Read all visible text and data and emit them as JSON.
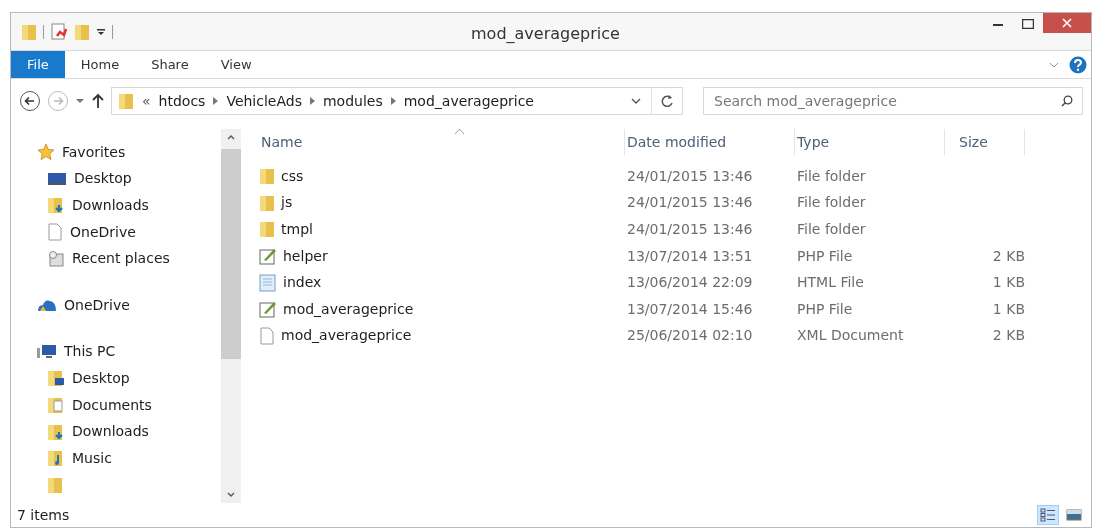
{
  "window": {
    "title": "mod_averageprice"
  },
  "ribbon_tabs": [
    {
      "label": "File",
      "selected": true
    },
    {
      "label": "Home",
      "selected": false
    },
    {
      "label": "Share",
      "selected": false
    },
    {
      "label": "View",
      "selected": false
    }
  ],
  "address": {
    "overflow": "«",
    "crumbs": [
      "htdocs",
      "VehicleAds",
      "modules",
      "mod_averageprice"
    ]
  },
  "search": {
    "placeholder": "Search mod_averageprice"
  },
  "sidebar": {
    "groups": [
      {
        "label": "Favorites",
        "kind": "star",
        "children": [
          {
            "label": "Desktop",
            "kind": "desktop"
          },
          {
            "label": "Downloads",
            "kind": "downloads"
          },
          {
            "label": "OneDrive",
            "kind": "page"
          },
          {
            "label": "Recent places",
            "kind": "recent"
          }
        ]
      },
      {
        "label": "OneDrive",
        "kind": "cloud"
      },
      {
        "label": "This PC",
        "kind": "pc",
        "children": [
          {
            "label": "Desktop",
            "kind": "desktop-folder"
          },
          {
            "label": "Documents",
            "kind": "documents"
          },
          {
            "label": "Downloads",
            "kind": "downloads"
          },
          {
            "label": "Music",
            "kind": "music"
          },
          {
            "kind": "folder"
          }
        ]
      }
    ]
  },
  "table": {
    "columns": [
      "Name",
      "Date modified",
      "Type",
      "Size"
    ],
    "rows": [
      {
        "kind": "folder",
        "name": "css",
        "date": "24/01/2015 13:46",
        "type": "File folder"
      },
      {
        "kind": "folder",
        "name": "js",
        "date": "24/01/2015 13:46",
        "type": "File folder"
      },
      {
        "kind": "folder",
        "name": "tmpl",
        "date": "24/01/2015 13:46",
        "type": "File folder"
      },
      {
        "kind": "php",
        "name": "helper",
        "date": "13/07/2014 13:51",
        "type": "PHP File",
        "size": "2 KB"
      },
      {
        "kind": "html",
        "name": "index",
        "date": "13/06/2014 22:09",
        "type": "HTML File",
        "size": "1 KB"
      },
      {
        "kind": "php",
        "name": "mod_averageprice",
        "date": "13/07/2014 15:46",
        "type": "PHP File",
        "size": "1 KB"
      },
      {
        "kind": "xml",
        "name": "mod_averageprice",
        "date": "25/06/2014 02:10",
        "type": "XML Document",
        "size": "2 KB"
      }
    ]
  },
  "status_bar": {
    "count": "7 items",
    "views": [
      {
        "kind": "details",
        "selected": true
      },
      {
        "kind": "thumbnails",
        "selected": false
      }
    ]
  }
}
